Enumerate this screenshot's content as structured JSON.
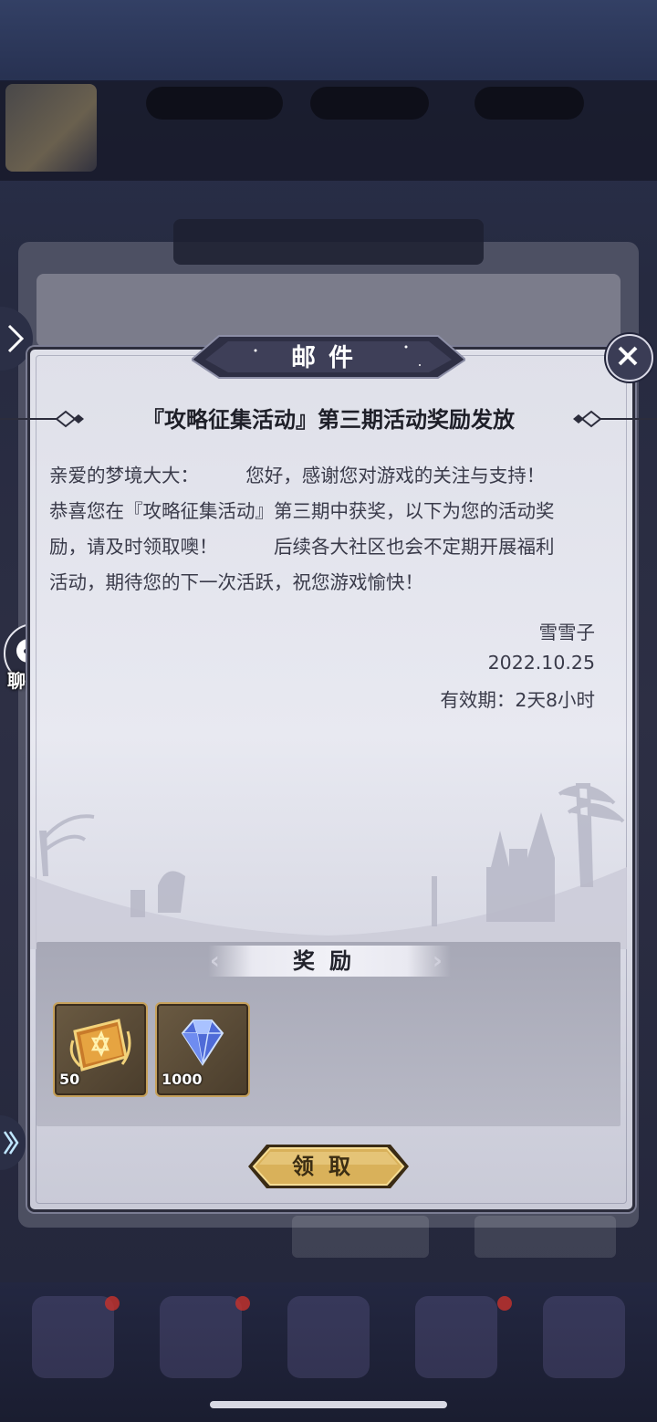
{
  "background": {
    "title_blurred": "邮件"
  },
  "dialog": {
    "title": "邮件",
    "mail_title": "『攻略征集活动』第三期活动奖励发放",
    "body": [
      "亲爱的梦境大大：　　　您好，感谢您对游戏的关注与支持！",
      "恭喜您在『攻略征集活动』第三期中获奖，以下为您的活动奖",
      "励，请及时领取噢！　　　后续各大社区也会不定期开展福利",
      "活动，期待您的下一次活跃，祝您游戏愉快！"
    ],
    "sender": "雪雪子",
    "date": "2022.10.25",
    "validity": "有效期：2天8小时"
  },
  "rewards": {
    "header": "奖励",
    "items": [
      {
        "icon": "golden-tome-icon",
        "count": "50"
      },
      {
        "icon": "diamond-icon",
        "count": "1000"
      }
    ]
  },
  "claim_button": "领取",
  "chat": {
    "label": "聊天"
  },
  "colors": {
    "dialog_bg": "#e3e4ec",
    "frame": "#2c2d3c",
    "gold_button": "#d9b15a",
    "reward_bg": "#afb0bd"
  }
}
